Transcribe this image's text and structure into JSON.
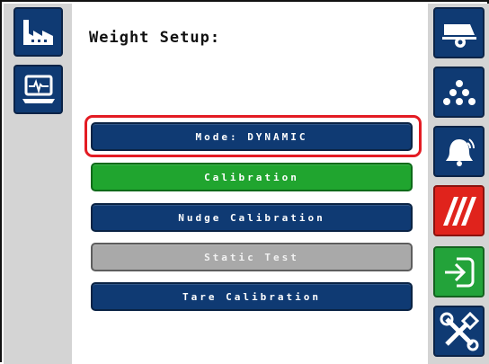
{
  "header": {
    "title": "Weight Setup:"
  },
  "menu": {
    "mode_label": "Mode: DYNAMIC",
    "calibration_label": "Calibration",
    "nudge_label": "Nudge Calibration",
    "static_test_label": "Static Test",
    "tare_label": "Tare Calibration"
  },
  "left_nav": [
    {
      "icon": "factory-icon"
    },
    {
      "icon": "monitor-diagnostics-icon"
    }
  ],
  "right_nav": [
    {
      "icon": "spreader-cart-icon"
    },
    {
      "icon": "dots-triangle-icon"
    },
    {
      "icon": "alarm-bell-icon"
    },
    {
      "icon": "stripes-icon"
    },
    {
      "icon": "enter-arrow-icon"
    },
    {
      "icon": "tools-icon"
    }
  ],
  "colors": {
    "primary_blue": "#0f3a73",
    "active_green": "#20a52f",
    "disabled_gray": "#a9a9a9",
    "highlight_red": "#e31b23",
    "alert_red": "#e0231c"
  }
}
